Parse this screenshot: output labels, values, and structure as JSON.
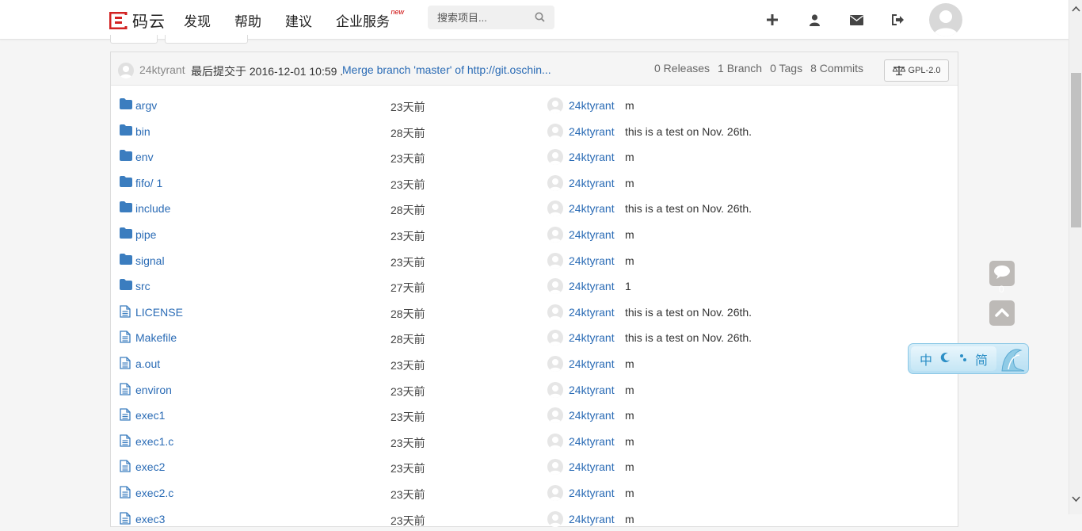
{
  "header": {
    "logo_text": "码云",
    "nav": [
      "发现",
      "帮助",
      "建议",
      "企业服务"
    ],
    "nav_badge": "new",
    "search_placeholder": "搜索项目..."
  },
  "repo_summary": {
    "user": "24ktyrant",
    "commit_text": "最后提交于 2016-12-01 10:59 .",
    "commit_message": "Merge branch 'master' of http://git.oschin...",
    "releases": "0 Releases",
    "branches": "1 Branch",
    "tags": "0 Tags",
    "commits": "8 Commits",
    "license": "GPL-2.0"
  },
  "files": [
    {
      "name": "argv",
      "type": "folder",
      "age": "23天前",
      "user": "24ktyrant",
      "msg": "m"
    },
    {
      "name": "bin",
      "type": "folder",
      "age": "28天前",
      "user": "24ktyrant",
      "msg": "this is a test on Nov. 26th."
    },
    {
      "name": "env",
      "type": "folder",
      "age": "23天前",
      "user": "24ktyrant",
      "msg": "m"
    },
    {
      "name": "fifo/ 1",
      "type": "folder",
      "age": "23天前",
      "user": "24ktyrant",
      "msg": "m"
    },
    {
      "name": "include",
      "type": "folder",
      "age": "28天前",
      "user": "24ktyrant",
      "msg": "this is a test on Nov. 26th."
    },
    {
      "name": "pipe",
      "type": "folder",
      "age": "23天前",
      "user": "24ktyrant",
      "msg": "m"
    },
    {
      "name": "signal",
      "type": "folder",
      "age": "23天前",
      "user": "24ktyrant",
      "msg": "m"
    },
    {
      "name": "src",
      "type": "folder",
      "age": "27天前",
      "user": "24ktyrant",
      "msg": "1"
    },
    {
      "name": "LICENSE",
      "type": "file",
      "age": "28天前",
      "user": "24ktyrant",
      "msg": "this is a test on Nov. 26th."
    },
    {
      "name": "Makefile",
      "type": "file",
      "age": "28天前",
      "user": "24ktyrant",
      "msg": "this is a test on Nov. 26th."
    },
    {
      "name": "a.out",
      "type": "file",
      "age": "23天前",
      "user": "24ktyrant",
      "msg": "m"
    },
    {
      "name": "environ",
      "type": "file",
      "age": "23天前",
      "user": "24ktyrant",
      "msg": "m"
    },
    {
      "name": "exec1",
      "type": "file",
      "age": "23天前",
      "user": "24ktyrant",
      "msg": "m"
    },
    {
      "name": "exec1.c",
      "type": "file",
      "age": "23天前",
      "user": "24ktyrant",
      "msg": "m"
    },
    {
      "name": "exec2",
      "type": "file",
      "age": "23天前",
      "user": "24ktyrant",
      "msg": "m"
    },
    {
      "name": "exec2.c",
      "type": "file",
      "age": "23天前",
      "user": "24ktyrant",
      "msg": "m"
    },
    {
      "name": "exec3",
      "type": "file",
      "age": "23天前",
      "user": "24ktyrant",
      "msg": "m"
    }
  ],
  "widgets": {
    "comment_count": "0",
    "ime_chars": [
      "中",
      "简"
    ]
  },
  "colors": {
    "link": "#2a6bb5",
    "folder": "#3b7dbf",
    "logo_red": "#d22222"
  }
}
